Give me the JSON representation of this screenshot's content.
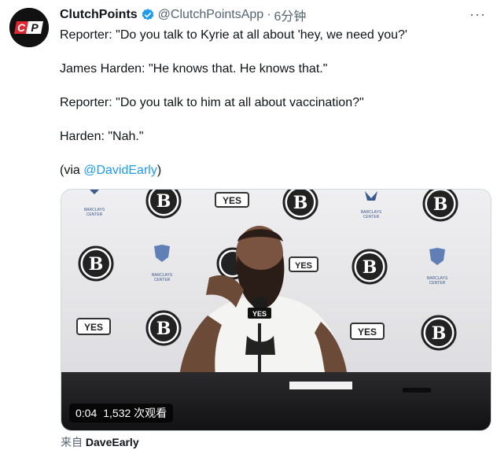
{
  "tweet": {
    "display_name": "ClutchPoints",
    "handle": "@ClutchPointsApp",
    "separator": "·",
    "time": "6分钟",
    "avatar_text": "CP",
    "lines": [
      "Reporter: \"Do you talk to Kyrie at all about 'hey, we need you?'",
      "James Harden: \"He knows that. He knows that.\"",
      "Reporter: \"Do you talk to him at all about vaccination?\"",
      "Harden: \"Nah.\""
    ],
    "via_prefix": "(via ",
    "via_mention": "@DavidEarly",
    "via_suffix": ")"
  },
  "media": {
    "time": "0:04",
    "views": "1,532 次观看",
    "logo_yes": "YES",
    "logo_b": "B",
    "logo_barclays": "BARCLAYS CENTER",
    "mic_label": "YES"
  },
  "source": {
    "prefix": "来自",
    "name": "DaveEarly"
  },
  "colors": {
    "link": "#1d9bf0",
    "verified": "#1d9bf0",
    "secondary_text": "#536471",
    "avatar_red": "#e0262e"
  }
}
